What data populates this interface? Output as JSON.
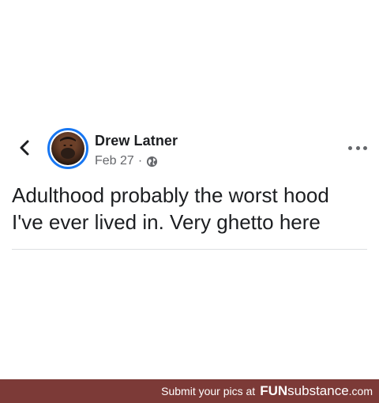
{
  "post": {
    "author": "Drew Latner",
    "date": "Feb 27",
    "separator": "·",
    "text": "Adulthood probably the worst hood\nI've ever lived in. Very ghetto here"
  },
  "icons": {
    "back": "chevron-left-icon",
    "globe": "globe-icon",
    "more": "more-horizontal-icon"
  },
  "footer": {
    "cta": "Submit your pics at",
    "brand_bold": "FUN",
    "brand_light": "substance",
    "brand_tld": ".com"
  },
  "colors": {
    "avatar_ring": "#1877f2",
    "name": "#1c1e21",
    "meta": "#65676b",
    "footer_bg": "#7c3a37"
  }
}
